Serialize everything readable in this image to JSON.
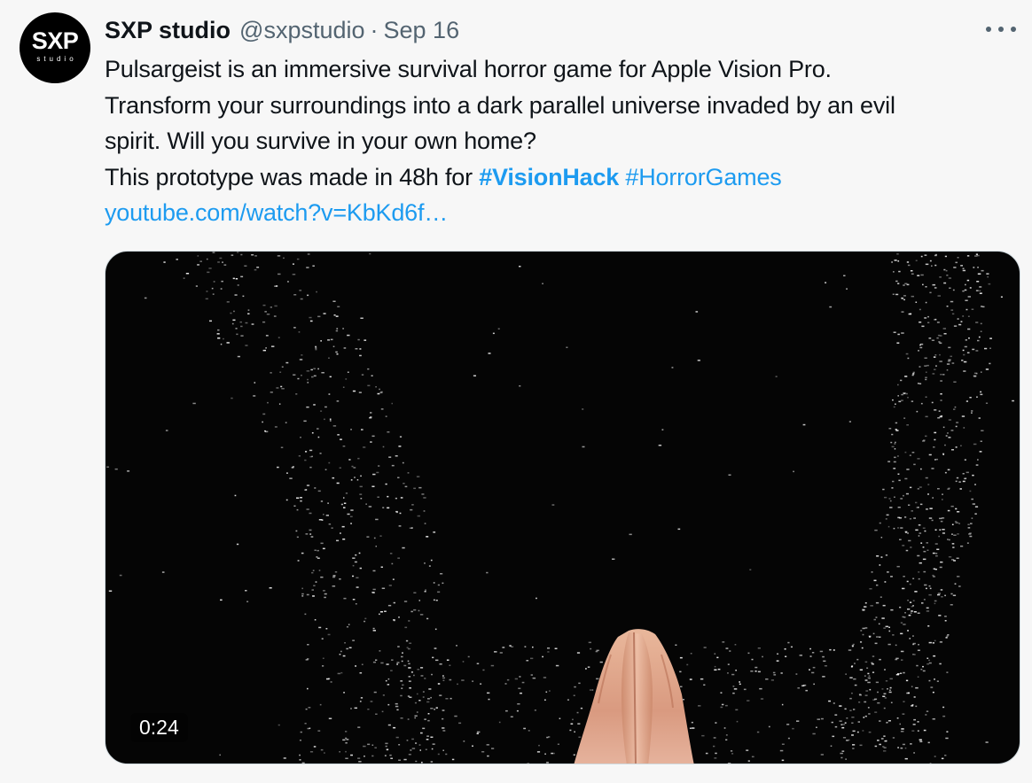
{
  "author": {
    "avatar_logo": "SXP",
    "avatar_sub": "studio",
    "name": "SXP studio",
    "handle": "@sxpstudio",
    "separator": "·",
    "date": "Sep 16"
  },
  "tweet": {
    "line1": "Pulsargeist is an immersive survival horror game for Apple Vision Pro.",
    "line2": "Transform your surroundings into a dark parallel universe invaded by an evil",
    "line3": "spirit. Will you survive in your own home?",
    "line4_prefix": "This prototype was made in 48h for ",
    "hashtag1": "#VisionHack",
    "hashtag2": "#HorrorGames",
    "link": "youtube.com/watch?v=KbKd6f…"
  },
  "media": {
    "duration": "0:24"
  },
  "colors": {
    "accent": "#1d9bf0",
    "muted": "#536471",
    "background": "#f7f7f7"
  },
  "icons": {
    "more": "more-horizontal-icon"
  }
}
